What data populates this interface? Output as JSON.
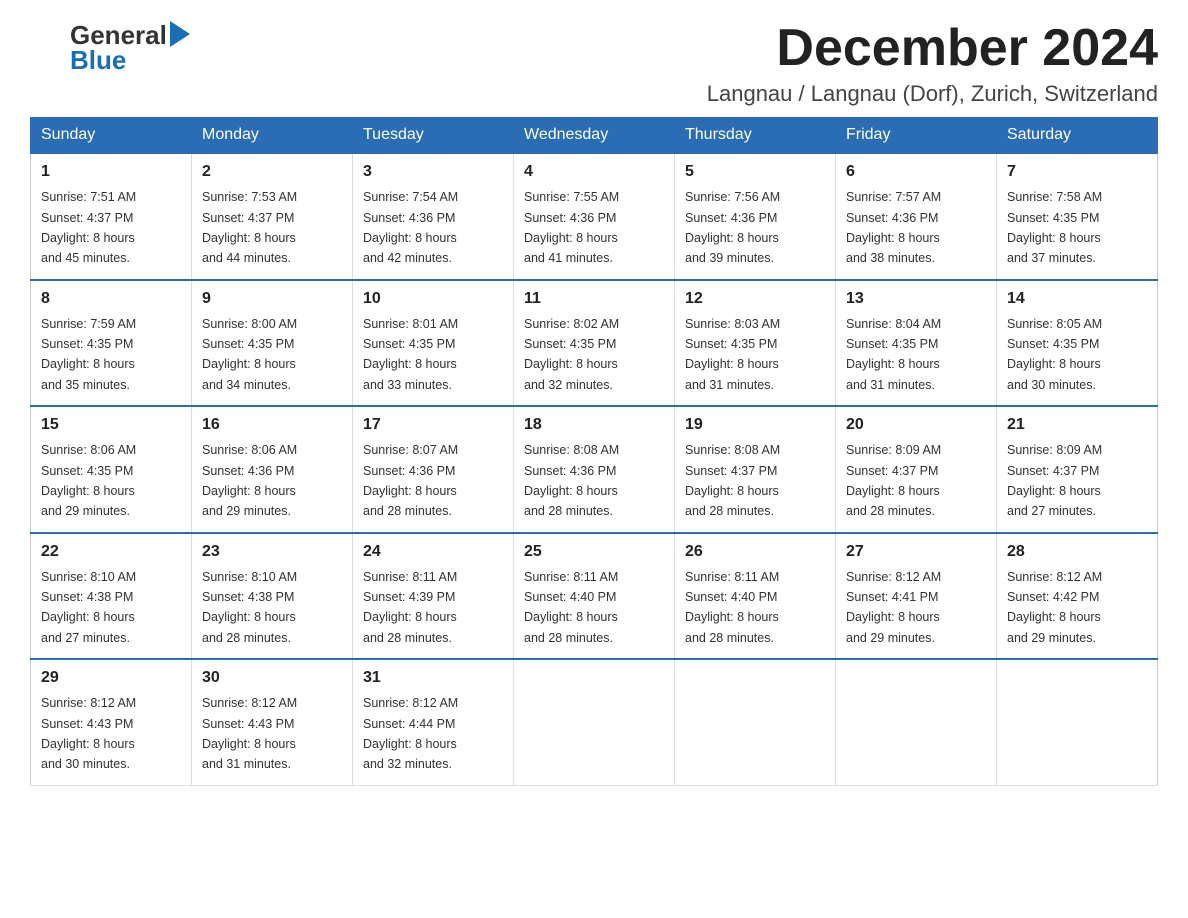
{
  "header": {
    "logo_general": "General",
    "logo_blue": "Blue",
    "month_title": "December 2024",
    "location": "Langnau / Langnau (Dorf), Zurich, Switzerland"
  },
  "weekdays": [
    "Sunday",
    "Monday",
    "Tuesday",
    "Wednesday",
    "Thursday",
    "Friday",
    "Saturday"
  ],
  "weeks": [
    [
      {
        "day": "1",
        "sunrise": "7:51 AM",
        "sunset": "4:37 PM",
        "daylight": "8 hours and 45 minutes."
      },
      {
        "day": "2",
        "sunrise": "7:53 AM",
        "sunset": "4:37 PM",
        "daylight": "8 hours and 44 minutes."
      },
      {
        "day": "3",
        "sunrise": "7:54 AM",
        "sunset": "4:36 PM",
        "daylight": "8 hours and 42 minutes."
      },
      {
        "day": "4",
        "sunrise": "7:55 AM",
        "sunset": "4:36 PM",
        "daylight": "8 hours and 41 minutes."
      },
      {
        "day": "5",
        "sunrise": "7:56 AM",
        "sunset": "4:36 PM",
        "daylight": "8 hours and 39 minutes."
      },
      {
        "day": "6",
        "sunrise": "7:57 AM",
        "sunset": "4:36 PM",
        "daylight": "8 hours and 38 minutes."
      },
      {
        "day": "7",
        "sunrise": "7:58 AM",
        "sunset": "4:35 PM",
        "daylight": "8 hours and 37 minutes."
      }
    ],
    [
      {
        "day": "8",
        "sunrise": "7:59 AM",
        "sunset": "4:35 PM",
        "daylight": "8 hours and 35 minutes."
      },
      {
        "day": "9",
        "sunrise": "8:00 AM",
        "sunset": "4:35 PM",
        "daylight": "8 hours and 34 minutes."
      },
      {
        "day": "10",
        "sunrise": "8:01 AM",
        "sunset": "4:35 PM",
        "daylight": "8 hours and 33 minutes."
      },
      {
        "day": "11",
        "sunrise": "8:02 AM",
        "sunset": "4:35 PM",
        "daylight": "8 hours and 32 minutes."
      },
      {
        "day": "12",
        "sunrise": "8:03 AM",
        "sunset": "4:35 PM",
        "daylight": "8 hours and 31 minutes."
      },
      {
        "day": "13",
        "sunrise": "8:04 AM",
        "sunset": "4:35 PM",
        "daylight": "8 hours and 31 minutes."
      },
      {
        "day": "14",
        "sunrise": "8:05 AM",
        "sunset": "4:35 PM",
        "daylight": "8 hours and 30 minutes."
      }
    ],
    [
      {
        "day": "15",
        "sunrise": "8:06 AM",
        "sunset": "4:35 PM",
        "daylight": "8 hours and 29 minutes."
      },
      {
        "day": "16",
        "sunrise": "8:06 AM",
        "sunset": "4:36 PM",
        "daylight": "8 hours and 29 minutes."
      },
      {
        "day": "17",
        "sunrise": "8:07 AM",
        "sunset": "4:36 PM",
        "daylight": "8 hours and 28 minutes."
      },
      {
        "day": "18",
        "sunrise": "8:08 AM",
        "sunset": "4:36 PM",
        "daylight": "8 hours and 28 minutes."
      },
      {
        "day": "19",
        "sunrise": "8:08 AM",
        "sunset": "4:37 PM",
        "daylight": "8 hours and 28 minutes."
      },
      {
        "day": "20",
        "sunrise": "8:09 AM",
        "sunset": "4:37 PM",
        "daylight": "8 hours and 28 minutes."
      },
      {
        "day": "21",
        "sunrise": "8:09 AM",
        "sunset": "4:37 PM",
        "daylight": "8 hours and 27 minutes."
      }
    ],
    [
      {
        "day": "22",
        "sunrise": "8:10 AM",
        "sunset": "4:38 PM",
        "daylight": "8 hours and 27 minutes."
      },
      {
        "day": "23",
        "sunrise": "8:10 AM",
        "sunset": "4:38 PM",
        "daylight": "8 hours and 28 minutes."
      },
      {
        "day": "24",
        "sunrise": "8:11 AM",
        "sunset": "4:39 PM",
        "daylight": "8 hours and 28 minutes."
      },
      {
        "day": "25",
        "sunrise": "8:11 AM",
        "sunset": "4:40 PM",
        "daylight": "8 hours and 28 minutes."
      },
      {
        "day": "26",
        "sunrise": "8:11 AM",
        "sunset": "4:40 PM",
        "daylight": "8 hours and 28 minutes."
      },
      {
        "day": "27",
        "sunrise": "8:12 AM",
        "sunset": "4:41 PM",
        "daylight": "8 hours and 29 minutes."
      },
      {
        "day": "28",
        "sunrise": "8:12 AM",
        "sunset": "4:42 PM",
        "daylight": "8 hours and 29 minutes."
      }
    ],
    [
      {
        "day": "29",
        "sunrise": "8:12 AM",
        "sunset": "4:43 PM",
        "daylight": "8 hours and 30 minutes."
      },
      {
        "day": "30",
        "sunrise": "8:12 AM",
        "sunset": "4:43 PM",
        "daylight": "8 hours and 31 minutes."
      },
      {
        "day": "31",
        "sunrise": "8:12 AM",
        "sunset": "4:44 PM",
        "daylight": "8 hours and 32 minutes."
      },
      null,
      null,
      null,
      null
    ]
  ],
  "labels": {
    "sunrise": "Sunrise:",
    "sunset": "Sunset:",
    "daylight": "Daylight:"
  }
}
